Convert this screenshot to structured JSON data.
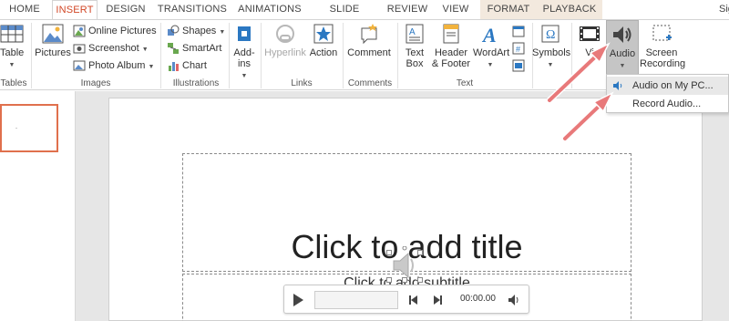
{
  "tabs": [
    {
      "label": "HOME",
      "active": false
    },
    {
      "label": "INSERT",
      "active": true
    },
    {
      "label": "DESIGN",
      "active": false
    },
    {
      "label": "TRANSITIONS",
      "active": false
    },
    {
      "label": "ANIMATIONS",
      "active": false
    },
    {
      "label": "SLIDE SHOW",
      "active": false
    },
    {
      "label": "REVIEW",
      "active": false
    },
    {
      "label": "VIEW",
      "active": false
    },
    {
      "label": "FORMAT",
      "active": false,
      "contextual": true
    },
    {
      "label": "PLAYBACK",
      "active": false,
      "contextual": true
    }
  ],
  "signin": "Sig",
  "ribbon": {
    "table": {
      "label": "Table"
    },
    "pictures": {
      "label": "Pictures"
    },
    "online_pictures": {
      "label": "Online Pictures"
    },
    "screenshot": {
      "label": "Screenshot"
    },
    "photo_album": {
      "label": "Photo Album"
    },
    "shapes": {
      "label": "Shapes"
    },
    "smartart": {
      "label": "SmartArt"
    },
    "chart": {
      "label": "Chart"
    },
    "addins": {
      "label": "Add-ins"
    },
    "hyperlink": {
      "label": "Hyperlink"
    },
    "action": {
      "label": "Action"
    },
    "comment": {
      "label": "Comment"
    },
    "textbox": {
      "label1": "Text",
      "label2": "Box"
    },
    "header_footer": {
      "label1": "Header",
      "label2": "& Footer"
    },
    "wordart": {
      "label": "WordArt"
    },
    "symbols": {
      "label": "Symbols"
    },
    "video": {
      "label": "Vi"
    },
    "audio": {
      "label": "Audio"
    },
    "screen_recording": {
      "label1": "Screen",
      "label2": "Recording"
    }
  },
  "groups": {
    "tables": "Tables",
    "images": "Images",
    "illustrations": "Illustrations",
    "links": "Links",
    "comments": "Comments",
    "text": "Text"
  },
  "audio_menu": {
    "items": [
      {
        "label": "Audio on My PC..."
      },
      {
        "label": "Record Audio..."
      }
    ]
  },
  "slide": {
    "title_placeholder": "Click to add title",
    "subtitle_placeholder": "Click to add subtitle"
  },
  "player": {
    "time": "00:00.00"
  },
  "colors": {
    "accent": "#d24726",
    "arrow": "#e8797a",
    "contextual_tab": "#f3e9de"
  }
}
